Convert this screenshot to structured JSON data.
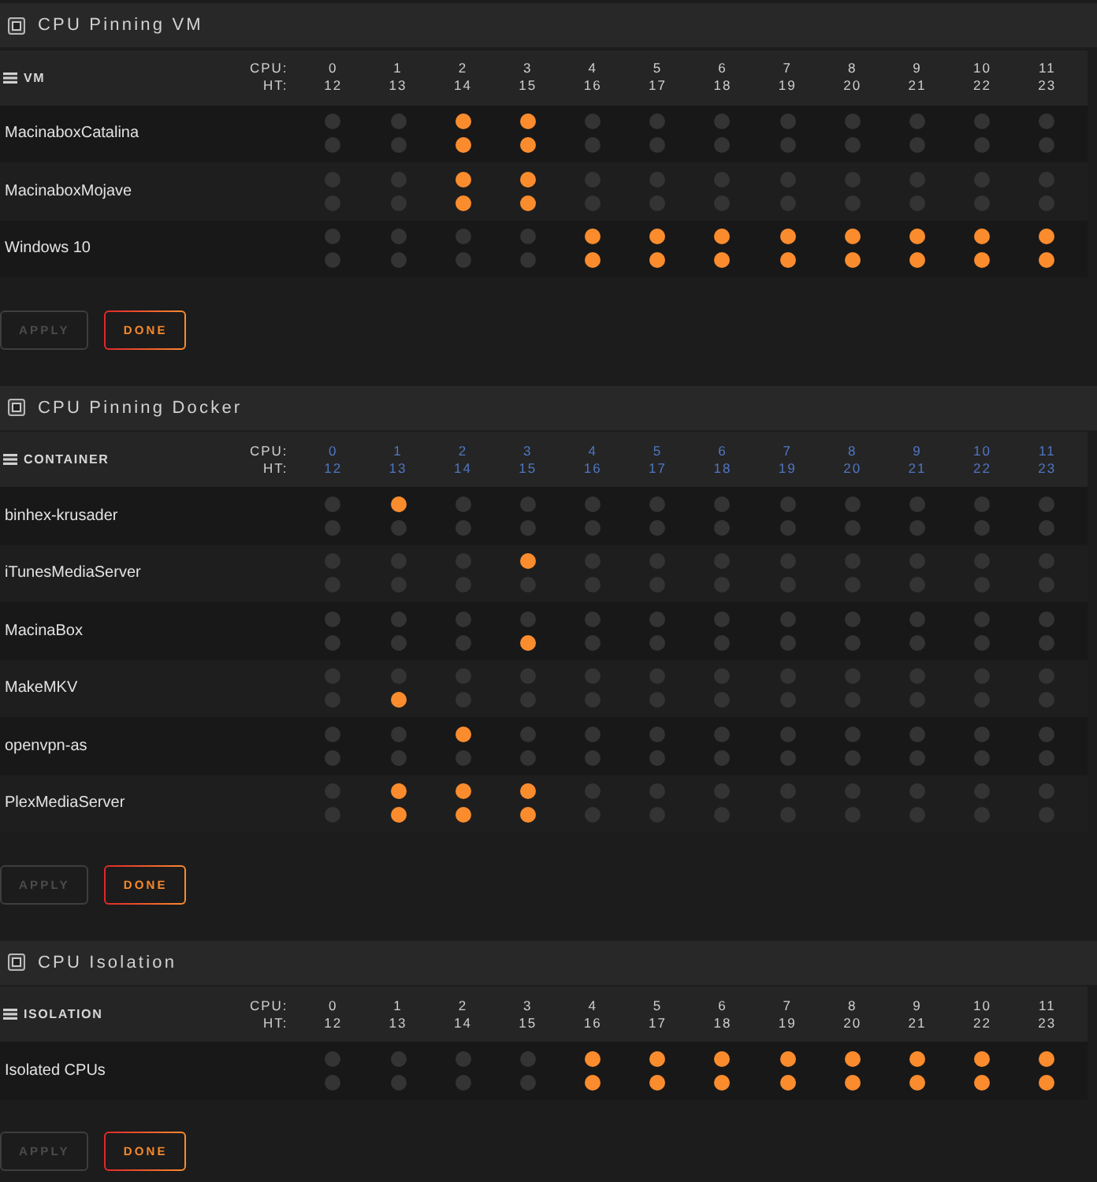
{
  "sections": [
    {
      "title": "CPU Pinning VM",
      "name_heading": "VM",
      "cpu_label": "CPU:",
      "ht_label": "HT:",
      "column_toggles": false,
      "columns": [
        {
          "cpu": "0",
          "ht": "12"
        },
        {
          "cpu": "1",
          "ht": "13"
        },
        {
          "cpu": "2",
          "ht": "14"
        },
        {
          "cpu": "3",
          "ht": "15"
        },
        {
          "cpu": "4",
          "ht": "16"
        },
        {
          "cpu": "5",
          "ht": "17"
        },
        {
          "cpu": "6",
          "ht": "18"
        },
        {
          "cpu": "7",
          "ht": "19"
        },
        {
          "cpu": "8",
          "ht": "20"
        },
        {
          "cpu": "9",
          "ht": "21"
        },
        {
          "cpu": "10",
          "ht": "22"
        },
        {
          "cpu": "11",
          "ht": "23"
        }
      ],
      "rows": [
        {
          "name": "MacinaboxCatalina",
          "cores": [
            {
              "cpu_checked": false,
              "ht_checked": false
            },
            {
              "cpu_checked": false,
              "ht_checked": false
            },
            {
              "cpu_checked": true,
              "ht_checked": true
            },
            {
              "cpu_checked": true,
              "ht_checked": true
            },
            {
              "cpu_checked": false,
              "ht_checked": false
            },
            {
              "cpu_checked": false,
              "ht_checked": false
            },
            {
              "cpu_checked": false,
              "ht_checked": false
            },
            {
              "cpu_checked": false,
              "ht_checked": false
            },
            {
              "cpu_checked": false,
              "ht_checked": false
            },
            {
              "cpu_checked": false,
              "ht_checked": false
            },
            {
              "cpu_checked": false,
              "ht_checked": false
            },
            {
              "cpu_checked": false,
              "ht_checked": false
            }
          ]
        },
        {
          "name": "MacinaboxMojave",
          "cores": [
            {
              "cpu_checked": false,
              "ht_checked": false
            },
            {
              "cpu_checked": false,
              "ht_checked": false
            },
            {
              "cpu_checked": true,
              "ht_checked": true
            },
            {
              "cpu_checked": true,
              "ht_checked": true
            },
            {
              "cpu_checked": false,
              "ht_checked": false
            },
            {
              "cpu_checked": false,
              "ht_checked": false
            },
            {
              "cpu_checked": false,
              "ht_checked": false
            },
            {
              "cpu_checked": false,
              "ht_checked": false
            },
            {
              "cpu_checked": false,
              "ht_checked": false
            },
            {
              "cpu_checked": false,
              "ht_checked": false
            },
            {
              "cpu_checked": false,
              "ht_checked": false
            },
            {
              "cpu_checked": false,
              "ht_checked": false
            }
          ]
        },
        {
          "name": "Windows 10",
          "cores": [
            {
              "cpu_checked": false,
              "ht_checked": false
            },
            {
              "cpu_checked": false,
              "ht_checked": false
            },
            {
              "cpu_checked": false,
              "ht_checked": false
            },
            {
              "cpu_checked": false,
              "ht_checked": false
            },
            {
              "cpu_checked": true,
              "ht_checked": true
            },
            {
              "cpu_checked": true,
              "ht_checked": true
            },
            {
              "cpu_checked": true,
              "ht_checked": true
            },
            {
              "cpu_checked": true,
              "ht_checked": true
            },
            {
              "cpu_checked": true,
              "ht_checked": true
            },
            {
              "cpu_checked": true,
              "ht_checked": true
            },
            {
              "cpu_checked": true,
              "ht_checked": true
            },
            {
              "cpu_checked": true,
              "ht_checked": true
            }
          ]
        }
      ],
      "buttons": [
        {
          "label": "APPLY",
          "disabled": true
        },
        {
          "label": "DONE",
          "disabled": false
        }
      ]
    },
    {
      "title": "CPU Pinning Docker",
      "name_heading": "CONTAINER",
      "cpu_label": "CPU:",
      "ht_label": "HT:",
      "column_toggles": true,
      "columns": [
        {
          "cpu": "0",
          "ht": "12"
        },
        {
          "cpu": "1",
          "ht": "13"
        },
        {
          "cpu": "2",
          "ht": "14"
        },
        {
          "cpu": "3",
          "ht": "15"
        },
        {
          "cpu": "4",
          "ht": "16"
        },
        {
          "cpu": "5",
          "ht": "17"
        },
        {
          "cpu": "6",
          "ht": "18"
        },
        {
          "cpu": "7",
          "ht": "19"
        },
        {
          "cpu": "8",
          "ht": "20"
        },
        {
          "cpu": "9",
          "ht": "21"
        },
        {
          "cpu": "10",
          "ht": "22"
        },
        {
          "cpu": "11",
          "ht": "23"
        }
      ],
      "rows": [
        {
          "name": "binhex-krusader",
          "cores": [
            {
              "cpu_checked": false,
              "ht_checked": false
            },
            {
              "cpu_checked": true,
              "ht_checked": false
            },
            {
              "cpu_checked": false,
              "ht_checked": false
            },
            {
              "cpu_checked": false,
              "ht_checked": false
            },
            {
              "cpu_checked": false,
              "ht_checked": false
            },
            {
              "cpu_checked": false,
              "ht_checked": false
            },
            {
              "cpu_checked": false,
              "ht_checked": false
            },
            {
              "cpu_checked": false,
              "ht_checked": false
            },
            {
              "cpu_checked": false,
              "ht_checked": false
            },
            {
              "cpu_checked": false,
              "ht_checked": false
            },
            {
              "cpu_checked": false,
              "ht_checked": false
            },
            {
              "cpu_checked": false,
              "ht_checked": false
            }
          ]
        },
        {
          "name": "iTunesMediaServer",
          "cores": [
            {
              "cpu_checked": false,
              "ht_checked": false
            },
            {
              "cpu_checked": false,
              "ht_checked": false
            },
            {
              "cpu_checked": false,
              "ht_checked": false
            },
            {
              "cpu_checked": true,
              "ht_checked": false
            },
            {
              "cpu_checked": false,
              "ht_checked": false
            },
            {
              "cpu_checked": false,
              "ht_checked": false
            },
            {
              "cpu_checked": false,
              "ht_checked": false
            },
            {
              "cpu_checked": false,
              "ht_checked": false
            },
            {
              "cpu_checked": false,
              "ht_checked": false
            },
            {
              "cpu_checked": false,
              "ht_checked": false
            },
            {
              "cpu_checked": false,
              "ht_checked": false
            },
            {
              "cpu_checked": false,
              "ht_checked": false
            }
          ]
        },
        {
          "name": "MacinaBox",
          "cores": [
            {
              "cpu_checked": false,
              "ht_checked": false
            },
            {
              "cpu_checked": false,
              "ht_checked": false
            },
            {
              "cpu_checked": false,
              "ht_checked": false
            },
            {
              "cpu_checked": false,
              "ht_checked": true
            },
            {
              "cpu_checked": false,
              "ht_checked": false
            },
            {
              "cpu_checked": false,
              "ht_checked": false
            },
            {
              "cpu_checked": false,
              "ht_checked": false
            },
            {
              "cpu_checked": false,
              "ht_checked": false
            },
            {
              "cpu_checked": false,
              "ht_checked": false
            },
            {
              "cpu_checked": false,
              "ht_checked": false
            },
            {
              "cpu_checked": false,
              "ht_checked": false
            },
            {
              "cpu_checked": false,
              "ht_checked": false
            }
          ]
        },
        {
          "name": "MakeMKV",
          "cores": [
            {
              "cpu_checked": false,
              "ht_checked": false
            },
            {
              "cpu_checked": false,
              "ht_checked": true
            },
            {
              "cpu_checked": false,
              "ht_checked": false
            },
            {
              "cpu_checked": false,
              "ht_checked": false
            },
            {
              "cpu_checked": false,
              "ht_checked": false
            },
            {
              "cpu_checked": false,
              "ht_checked": false
            },
            {
              "cpu_checked": false,
              "ht_checked": false
            },
            {
              "cpu_checked": false,
              "ht_checked": false
            },
            {
              "cpu_checked": false,
              "ht_checked": false
            },
            {
              "cpu_checked": false,
              "ht_checked": false
            },
            {
              "cpu_checked": false,
              "ht_checked": false
            },
            {
              "cpu_checked": false,
              "ht_checked": false
            }
          ]
        },
        {
          "name": "openvpn-as",
          "cores": [
            {
              "cpu_checked": false,
              "ht_checked": false
            },
            {
              "cpu_checked": false,
              "ht_checked": false
            },
            {
              "cpu_checked": true,
              "ht_checked": false
            },
            {
              "cpu_checked": false,
              "ht_checked": false
            },
            {
              "cpu_checked": false,
              "ht_checked": false
            },
            {
              "cpu_checked": false,
              "ht_checked": false
            },
            {
              "cpu_checked": false,
              "ht_checked": false
            },
            {
              "cpu_checked": false,
              "ht_checked": false
            },
            {
              "cpu_checked": false,
              "ht_checked": false
            },
            {
              "cpu_checked": false,
              "ht_checked": false
            },
            {
              "cpu_checked": false,
              "ht_checked": false
            },
            {
              "cpu_checked": false,
              "ht_checked": false
            }
          ]
        },
        {
          "name": "PlexMediaServer",
          "cores": [
            {
              "cpu_checked": false,
              "ht_checked": false
            },
            {
              "cpu_checked": true,
              "ht_checked": true
            },
            {
              "cpu_checked": true,
              "ht_checked": true
            },
            {
              "cpu_checked": true,
              "ht_checked": true
            },
            {
              "cpu_checked": false,
              "ht_checked": false
            },
            {
              "cpu_checked": false,
              "ht_checked": false
            },
            {
              "cpu_checked": false,
              "ht_checked": false
            },
            {
              "cpu_checked": false,
              "ht_checked": false
            },
            {
              "cpu_checked": false,
              "ht_checked": false
            },
            {
              "cpu_checked": false,
              "ht_checked": false
            },
            {
              "cpu_checked": false,
              "ht_checked": false
            },
            {
              "cpu_checked": false,
              "ht_checked": false
            }
          ]
        }
      ],
      "buttons": [
        {
          "label": "APPLY",
          "disabled": true
        },
        {
          "label": "DONE",
          "disabled": false
        }
      ]
    },
    {
      "title": "CPU Isolation",
      "name_heading": "ISOLATION",
      "cpu_label": "CPU:",
      "ht_label": "HT:",
      "column_toggles": false,
      "columns": [
        {
          "cpu": "0",
          "ht": "12"
        },
        {
          "cpu": "1",
          "ht": "13"
        },
        {
          "cpu": "2",
          "ht": "14"
        },
        {
          "cpu": "3",
          "ht": "15"
        },
        {
          "cpu": "4",
          "ht": "16"
        },
        {
          "cpu": "5",
          "ht": "17"
        },
        {
          "cpu": "6",
          "ht": "18"
        },
        {
          "cpu": "7",
          "ht": "19"
        },
        {
          "cpu": "8",
          "ht": "20"
        },
        {
          "cpu": "9",
          "ht": "21"
        },
        {
          "cpu": "10",
          "ht": "22"
        },
        {
          "cpu": "11",
          "ht": "23"
        }
      ],
      "rows": [
        {
          "name": "Isolated CPUs",
          "cores": [
            {
              "cpu_checked": false,
              "ht_checked": false
            },
            {
              "cpu_checked": false,
              "ht_checked": false
            },
            {
              "cpu_checked": false,
              "ht_checked": false
            },
            {
              "cpu_checked": false,
              "ht_checked": false
            },
            {
              "cpu_checked": true,
              "ht_checked": true
            },
            {
              "cpu_checked": true,
              "ht_checked": true
            },
            {
              "cpu_checked": true,
              "ht_checked": true
            },
            {
              "cpu_checked": true,
              "ht_checked": true
            },
            {
              "cpu_checked": true,
              "ht_checked": true
            },
            {
              "cpu_checked": true,
              "ht_checked": true
            },
            {
              "cpu_checked": true,
              "ht_checked": true
            },
            {
              "cpu_checked": true,
              "ht_checked": true
            }
          ]
        }
      ],
      "buttons": [
        {
          "label": "APPLY",
          "disabled": true
        },
        {
          "label": "DONE",
          "disabled": false
        }
      ]
    }
  ]
}
